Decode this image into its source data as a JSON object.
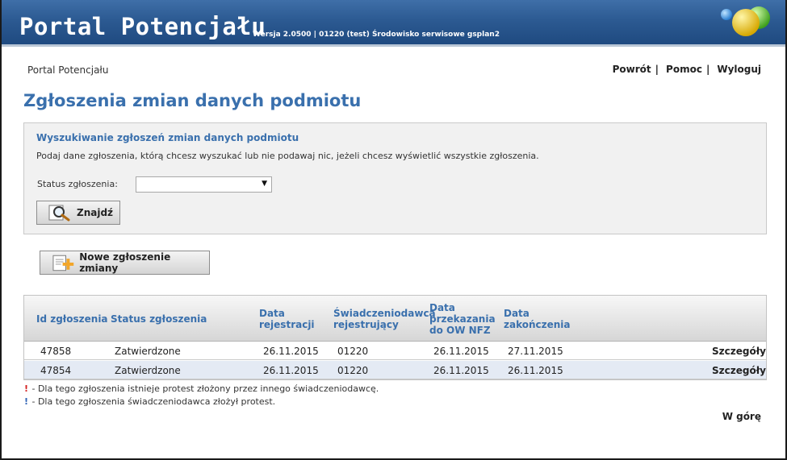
{
  "header": {
    "title": "Portal Potencjału",
    "version": "Wersja 2.0500 | 01220 (test) Środowisko serwisowe gsplan2"
  },
  "breadcrumb": "Portal Potencjału",
  "nav": {
    "back": "Powrót",
    "help": "Pomoc",
    "logout": "Wyloguj",
    "separator": "|"
  },
  "page_title": "Zgłoszenia zmian danych podmiotu",
  "search": {
    "title": "Wyszukiwanie zgłoszeń zmian danych podmiotu",
    "hint": "Podaj dane zgłoszenia, którą chcesz wyszukać lub nie podawaj nic, jeżeli chcesz wyświetlić wszystkie zgłoszenia.",
    "status_label": "Status zgłoszenia:",
    "status_value": "",
    "find_label": "Znajdź"
  },
  "new_request_label": "Nowe zgłoszenie zmiany",
  "table": {
    "headers": {
      "id": "Id zgłoszenia",
      "status": "Status zgłoszenia",
      "reg_date": "Data rejestracji",
      "provider": "Świadczeniodawca rejestrujący",
      "transfer_date": "Data przekazania do OW NFZ",
      "end_date": "Data zakończenia"
    },
    "rows": [
      {
        "id": "47858",
        "status": "Zatwierdzone",
        "reg_date": "26.11.2015",
        "provider": "01220",
        "transfer_date": "26.11.2015",
        "end_date": "27.11.2015",
        "details": "Szczegóły"
      },
      {
        "id": "47854",
        "status": "Zatwierdzone",
        "reg_date": "26.11.2015",
        "provider": "01220",
        "transfer_date": "26.11.2015",
        "end_date": "26.11.2015",
        "details": "Szczegóły"
      }
    ]
  },
  "legend": [
    {
      "mark": "!",
      "color": "#d42020",
      "text": " - Dla tego zgłoszenia istnieje protest złożony przez innego świadczeniodawcę."
    },
    {
      "mark": "!",
      "color": "#2f63b5",
      "text": " - Dla tego zgłoszenia świadczeniodawca złożył protest."
    }
  ],
  "top_link": "W górę",
  "colors": {
    "header": "#2c5a92",
    "accent_text": "#3a70ad",
    "alt_row": "#e4eaf4"
  }
}
